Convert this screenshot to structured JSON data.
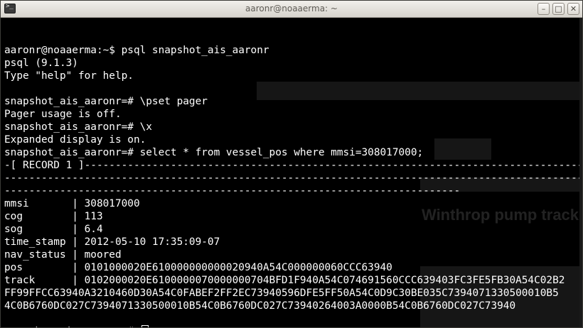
{
  "window": {
    "title": "aaronr@noaaerma: ~",
    "minimize_glyph": "–",
    "maximize_glyph": "□",
    "close_glyph": "✕"
  },
  "background_ghost": {
    "headline": "Winthrop pump track"
  },
  "terminal": {
    "lines": [
      "",
      "aaronr@noaaerma:~$ psql snapshot_ais_aaronr",
      "psql (9.1.3)",
      "Type \"help\" for help.",
      "",
      "snapshot_ais_aaronr=# \\pset pager",
      "Pager usage is off.",
      "snapshot_ais_aaronr=# \\x",
      "Expanded display is on.",
      "snapshot_ais_aaronr=# select * from vessel_pos where mmsi=308017000;",
      "-[ RECORD 1 ]---------------------------------------------------------------------------------",
      "-----------------------------------------------------------------------------------------------",
      "--------------------------------------------------------------------------",
      "mmsi       | 308017000",
      "cog        | 113",
      "sog        | 6.4",
      "time_stamp | 2012-05-10 17:35:09-07",
      "nav_status | moored",
      "pos        | 0101000020E610000000000020940A54C000000060CCC63940",
      "track      | 0102000020E6100000070000000704BFD1F940A54C074691560CCC639403FC3FE5FB30A54C02B2",
      "FF99FFCC63940A3210460D30A54C0FABEF2FF2EC73940596DFE5FF50A54C0D9C30BE035C7394071330500010B5",
      "4C0B6760DC027C7394071330500010B54C0B6760DC027C73940264003A0000B54C0B6760DC027C73940",
      "",
      "snapshot_ais_aaronr=# "
    ]
  }
}
